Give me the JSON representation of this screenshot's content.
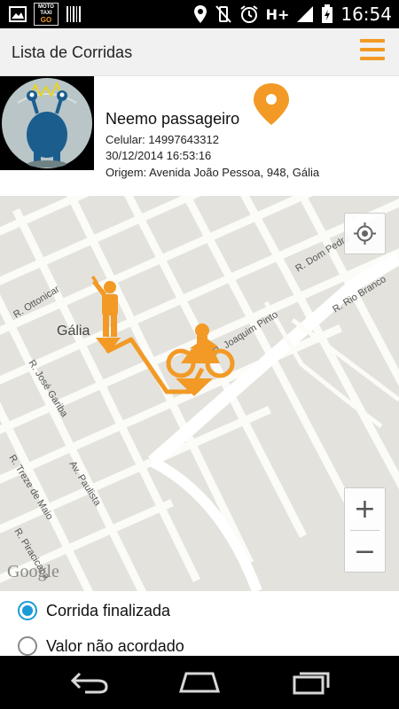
{
  "status_bar": {
    "network_type": "H+",
    "time": "16:54",
    "icons_left": [
      "image-icon",
      "app-logo-icon",
      "barcode-icon"
    ],
    "icons_right": [
      "location-pin-icon",
      "vibrate-off-icon",
      "alarm-icon",
      "signal-icon",
      "battery-charging-icon"
    ],
    "logo_text": [
      "MOTO",
      "TAXI",
      "GO"
    ]
  },
  "app_bar": {
    "title": "Lista de Corridas"
  },
  "passenger": {
    "name": "Neemo passageiro",
    "phone": "Celular: 14997643312",
    "datetime": "30/12/2014 16:53:16",
    "origin": "Origem: Avenida João Pessoa, 948, Gália"
  },
  "map": {
    "city_label": "Gália",
    "street_labels": {
      "ottonicar": "R. Ottonicar",
      "jose_gariba": "R. José Gariba",
      "treze_maio": "R. Treze de Maio",
      "paulista": "Av. Paulista",
      "piracicaba": "R. Piracicaba",
      "joaquim_pinto": "R. Joaquim Pinto",
      "dom_pedro": "R. Dom Pedro",
      "rio_branco": "R. Rio Branco"
    },
    "watermark": "Google",
    "zoom_in": "+",
    "zoom_out": "−",
    "route_color": "#f29a25"
  },
  "ride_options": {
    "options": [
      {
        "label": "Corrida finalizada",
        "checked": true
      },
      {
        "label": "Valor não acordado",
        "checked": false
      }
    ]
  },
  "accent_color": "#f29a25",
  "radio_color": "#1a9bd7"
}
